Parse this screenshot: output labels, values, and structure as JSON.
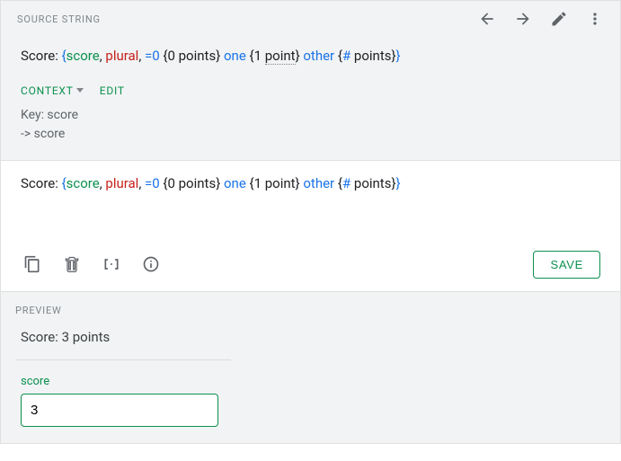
{
  "source": {
    "label": "SOURCE STRING",
    "prefix": "Score: ",
    "tokens": {
      "brace_open": "{",
      "score": "score",
      "comma1": ", ",
      "plural": "plural",
      "comma2": ", ",
      "eq0": "=0 ",
      "zero": "{0 points}",
      "one_kw": " one ",
      "one_l": "{",
      "one_txt": "1 ",
      "point": "point",
      "one_r": "}",
      "other_kw": " other ",
      "other_l": "{",
      "hash": "#",
      "points": " points",
      "other_r": "}",
      "brace_close": "}"
    }
  },
  "context": {
    "btn": "CONTEXT",
    "edit": "EDIT",
    "line1": "Key: score",
    "line2": "-> score"
  },
  "editor": {
    "prefix": "Score: ",
    "save": "SAVE"
  },
  "preview": {
    "label": "PREVIEW",
    "text": "Score: 3 points",
    "input_label": "score",
    "input_value": "3"
  }
}
